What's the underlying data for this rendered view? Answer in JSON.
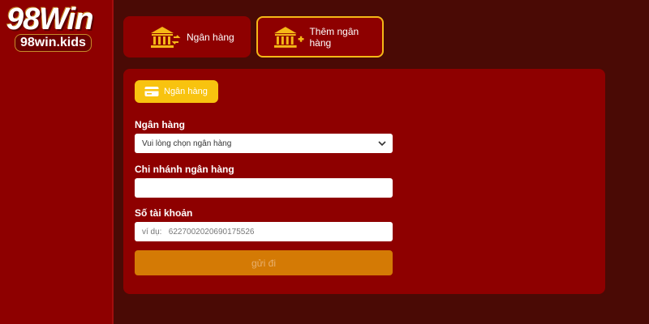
{
  "brand": {
    "logo_main": "98Win",
    "logo_sub": "98win.kids"
  },
  "tabs": [
    {
      "label": "Ngân hàng",
      "icon": "bank-transfer-icon"
    },
    {
      "label": "Thêm ngân hàng",
      "icon": "bank-add-icon"
    }
  ],
  "panel": {
    "badge": {
      "label": "Ngân hàng",
      "icon": "credit-card-icon"
    },
    "fields": {
      "bank": {
        "label": "Ngân hàng",
        "value": "Vui lòng chọn ngân hàng"
      },
      "branch": {
        "label": "Chi nhánh ngân hàng",
        "placeholder": ""
      },
      "account": {
        "label": "Số tài khoản",
        "placeholder": "ví dụ:   6227002020690175526"
      }
    },
    "submit_label": "gửi đi"
  },
  "colors": {
    "background": "#4a0a05",
    "panel": "#8e0000",
    "accent_gold": "#f5b817",
    "submit": "#d47a05"
  }
}
